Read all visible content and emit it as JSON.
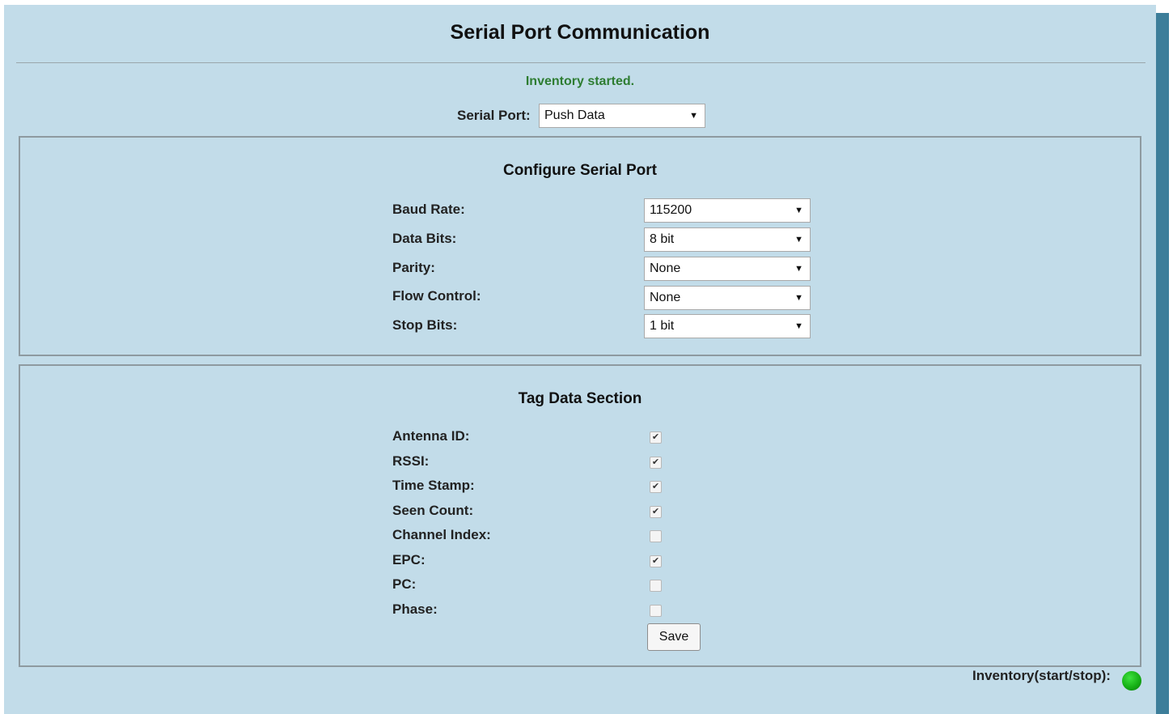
{
  "page": {
    "title": "Serial Port Communication",
    "status_message": "Inventory started.",
    "status_color": "#2e7d32"
  },
  "serial_port": {
    "label": "Serial Port:",
    "selected": "Push Data"
  },
  "configure": {
    "title": "Configure Serial Port",
    "rows": [
      {
        "label": "Baud Rate:",
        "value": "115200"
      },
      {
        "label": "Data Bits:",
        "value": "8 bit"
      },
      {
        "label": "Parity:",
        "value": "None"
      },
      {
        "label": "Flow Control:",
        "value": "None"
      },
      {
        "label": "Stop Bits:",
        "value": "1 bit"
      }
    ]
  },
  "tag_data": {
    "title": "Tag Data Section",
    "rows": [
      {
        "label": "Antenna ID:",
        "checked": true
      },
      {
        "label": "RSSI:",
        "checked": true
      },
      {
        "label": "Time Stamp:",
        "checked": true
      },
      {
        "label": "Seen Count:",
        "checked": true
      },
      {
        "label": "Channel Index:",
        "checked": false
      },
      {
        "label": "EPC:",
        "checked": true
      },
      {
        "label": "PC:",
        "checked": false
      },
      {
        "label": "Phase:",
        "checked": false
      }
    ],
    "save_label": "Save"
  },
  "inventory": {
    "label": "Inventory(start/stop):",
    "indicator_color": "#16b016"
  },
  "icons": {
    "select_arrow": "caret-down-icon",
    "check_mark": "checkmark-icon",
    "status_led": "green-led-icon"
  }
}
